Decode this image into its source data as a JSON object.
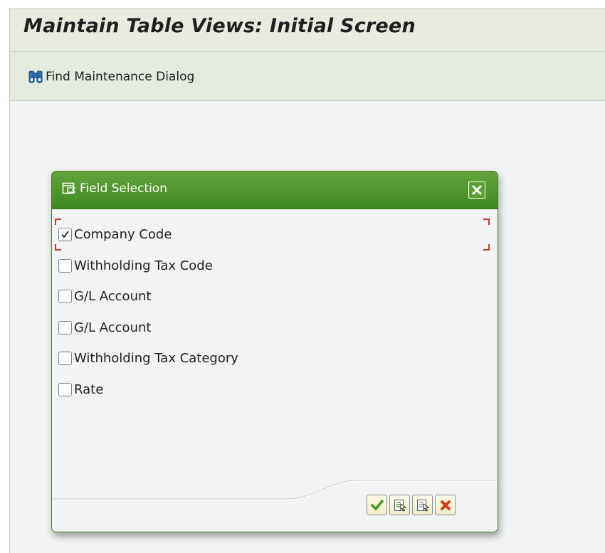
{
  "title": "Maintain Table Views: Initial Screen",
  "toolbar": {
    "find_label": "Find Maintenance Dialog",
    "find_icon": "binoculars-icon"
  },
  "dialog": {
    "title": "Field Selection",
    "title_icon": "field-selection-icon",
    "close_icon": "close-icon",
    "fields": [
      {
        "label": "Company Code",
        "checked": true
      },
      {
        "label": "Withholding Tax Code",
        "checked": false
      },
      {
        "label": "G/L Account",
        "checked": false
      },
      {
        "label": "G/L Account",
        "checked": false
      },
      {
        "label": "Withholding Tax Category",
        "checked": false
      },
      {
        "label": "Rate",
        "checked": false
      }
    ],
    "footer_buttons": [
      {
        "icon": "confirm-check-icon"
      },
      {
        "icon": "select-all-icon"
      },
      {
        "icon": "deselect-all-icon"
      },
      {
        "icon": "cancel-icon"
      }
    ]
  },
  "colors": {
    "dialog_header": "#4a922a",
    "focus_marker": "#d9312a",
    "cancel_red": "#d43a1a",
    "confirm_green": "#3f9a23"
  }
}
